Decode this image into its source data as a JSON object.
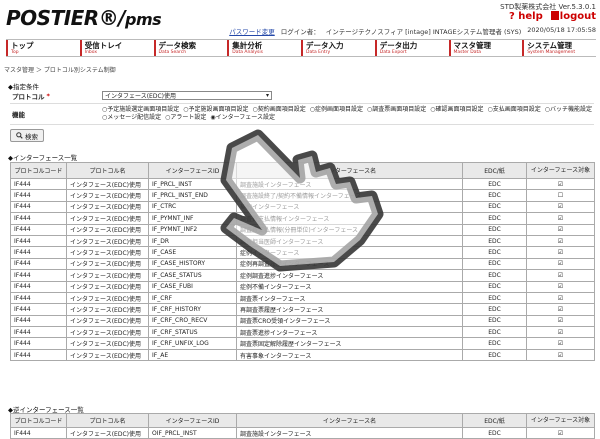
{
  "header": {
    "logo_main": "POSTIER",
    "logo_sub": "pms",
    "version": "STD製薬株式会社 Ver.5.3.0.1",
    "help": "? help",
    "logout": "logout",
    "password_link": "パスワード変更",
    "login_label": "ログイン者：",
    "login_user": "インテージテクノスフィア [intage] INTAGEシステム管理者 (SYS)",
    "datetime": "2020/05/18 17:05:58"
  },
  "nav": [
    {
      "ja": "トップ",
      "en": "Top"
    },
    {
      "ja": "受信トレイ",
      "en": "Inbox"
    },
    {
      "ja": "データ検索",
      "en": "Data Search"
    },
    {
      "ja": "集計分析",
      "en": "Data Analysis"
    },
    {
      "ja": "データ入力",
      "en": "Data Entry"
    },
    {
      "ja": "データ出力",
      "en": "Data Export"
    },
    {
      "ja": "マスタ管理",
      "en": "Master Data"
    },
    {
      "ja": "システム管理",
      "en": "System Management"
    }
  ],
  "breadcrumb": "マスタ管理 ＞ プロトコル別システム制御",
  "conditions": {
    "title": "◆指定条件",
    "protocol_label": "プロトコル",
    "required_mark": "*",
    "protocol_value": "インタフェース(EDC)使用",
    "function_label": "機能",
    "functions": [
      "○予定施設選定画面項目設定",
      "○予定施設画面項目設定",
      "○契約画面項目設定",
      "○症例画面項目設定",
      "○調査票画面項目設定",
      "○確認画面項目設定",
      "○支払画面項目設定",
      "○バッチ機能設定",
      "○メッセージ配信設定",
      "○アラート設定",
      "◉インターフェース設定"
    ],
    "search_button": "検索",
    "search_icon": "magnifier-icon"
  },
  "in_table": {
    "title": "◆インターフェース一覧",
    "headers": [
      "プロトコルコード",
      "プロトコル名",
      "インターフェースID",
      "インターフェース名",
      "EDC/紙",
      "インターフェース対象"
    ],
    "rows": [
      [
        "IF444",
        "インタフェース(EDC)使用",
        "IF_PRCL_INST",
        "調査施設インターフェース",
        "EDC",
        "☑"
      ],
      [
        "IF444",
        "インタフェース(EDC)使用",
        "IF_PRCL_INST_END",
        "調査施設終了/契約不備情報インターフェース",
        "EDC",
        "☐"
      ],
      [
        "IF444",
        "インタフェース(EDC)使用",
        "IF_CTRC",
        "契約インターフェース",
        "EDC",
        "☑"
      ],
      [
        "IF444",
        "インタフェース(EDC)使用",
        "IF_PYMNT_INF",
        "調査費支払情報インターフェース",
        "EDC",
        "☑"
      ],
      [
        "IF444",
        "インタフェース(EDC)使用",
        "IF_PYMNT_INF2",
        "調査費支払情報(分冊単位)インターフェース",
        "EDC",
        "☑"
      ],
      [
        "IF444",
        "インタフェース(EDC)使用",
        "IF_DR",
        "調査担当医師インターフェース",
        "EDC",
        "☑"
      ],
      [
        "IF444",
        "インタフェース(EDC)使用",
        "IF_CASE",
        "症例インターフェース",
        "EDC",
        "☑"
      ],
      [
        "IF444",
        "インタフェース(EDC)使用",
        "IF_CASE_HISTORY",
        "症例再調査履歴インターフェース",
        "EDC",
        "☑"
      ],
      [
        "IF444",
        "インタフェース(EDC)使用",
        "IF_CASE_STATUS",
        "症例調査進捗インターフェース",
        "EDC",
        "☑"
      ],
      [
        "IF444",
        "インタフェース(EDC)使用",
        "IF_CASE_FUBI",
        "症例不備インターフェース",
        "EDC",
        "☑"
      ],
      [
        "IF444",
        "インタフェース(EDC)使用",
        "IF_CRF",
        "調査票インターフェース",
        "EDC",
        "☑"
      ],
      [
        "IF444",
        "インタフェース(EDC)使用",
        "IF_CRF_HISTORY",
        "再調査票履歴インターフェース",
        "EDC",
        "☑"
      ],
      [
        "IF444",
        "インタフェース(EDC)使用",
        "IF_CRF_CRO_RECV",
        "調査票CRO受領インターフェース",
        "EDC",
        "☑"
      ],
      [
        "IF444",
        "インタフェース(EDC)使用",
        "IF_CRF_STATUS",
        "調査票進捗インターフェース",
        "EDC",
        "☑"
      ],
      [
        "IF444",
        "インタフェース(EDC)使用",
        "IF_CRF_UNFIX_LOG",
        "調査票固定解除履歴インターフェース",
        "EDC",
        "☑"
      ],
      [
        "IF444",
        "インタフェース(EDC)使用",
        "IF_AE",
        "有害事象インターフェース",
        "EDC",
        "☑"
      ]
    ]
  },
  "out_table": {
    "title": "◆逆インターフェース一覧",
    "headers": [
      "プロトコルコード",
      "プロトコル名",
      "インターフェースID",
      "インターフェース名",
      "EDC/紙",
      "インターフェース対象"
    ],
    "rows": [
      [
        "IF444",
        "インタフェース(EDC)使用",
        "OIF_PRCL_INST",
        "調査施設インターフェース",
        "EDC",
        "☑"
      ]
    ]
  },
  "overlay_icon": "pointing-hand-cursor-icon"
}
